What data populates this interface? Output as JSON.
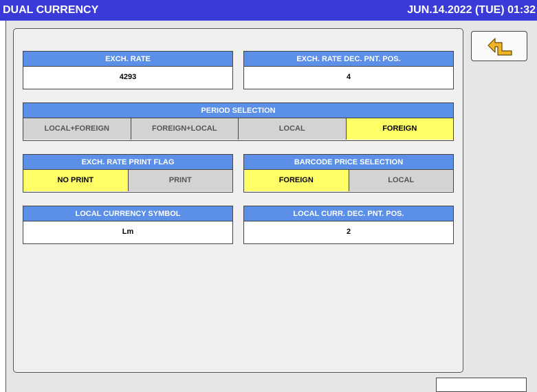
{
  "header": {
    "title": "DUAL CURRENCY",
    "datetime": "JUN.14.2022 (TUE)  01:32"
  },
  "exch_rate": {
    "label": "EXCH. RATE",
    "value": "4293"
  },
  "exch_rate_dec": {
    "label": "EXCH. RATE DEC. PNT. POS.",
    "value": "4"
  },
  "period_selection": {
    "label": "PERIOD SELECTION",
    "options": [
      "LOCAL+FOREIGN",
      "FOREIGN+LOCAL",
      "LOCAL",
      "FOREIGN"
    ],
    "selected": "FOREIGN"
  },
  "print_flag": {
    "label": "EXCH. RATE PRINT FLAG",
    "options": [
      "NO PRINT",
      "PRINT"
    ],
    "selected": "NO PRINT"
  },
  "barcode_price": {
    "label": "BARCODE PRICE SELECTION",
    "options": [
      "FOREIGN",
      "LOCAL"
    ],
    "selected": "FOREIGN"
  },
  "local_symbol": {
    "label": "LOCAL CURRENCY SYMBOL",
    "value": "Lm"
  },
  "local_dec": {
    "label": "LOCAL CURR. DEC. PNT. POS.",
    "value": "2"
  },
  "icons": {
    "back": "return-arrow-icon"
  },
  "colors": {
    "titlebar": "#3a3ad8",
    "header": "#5b8fe8",
    "selected": "#ffff66",
    "unselected": "#d3d3d3",
    "arrow": "#f0b428"
  }
}
